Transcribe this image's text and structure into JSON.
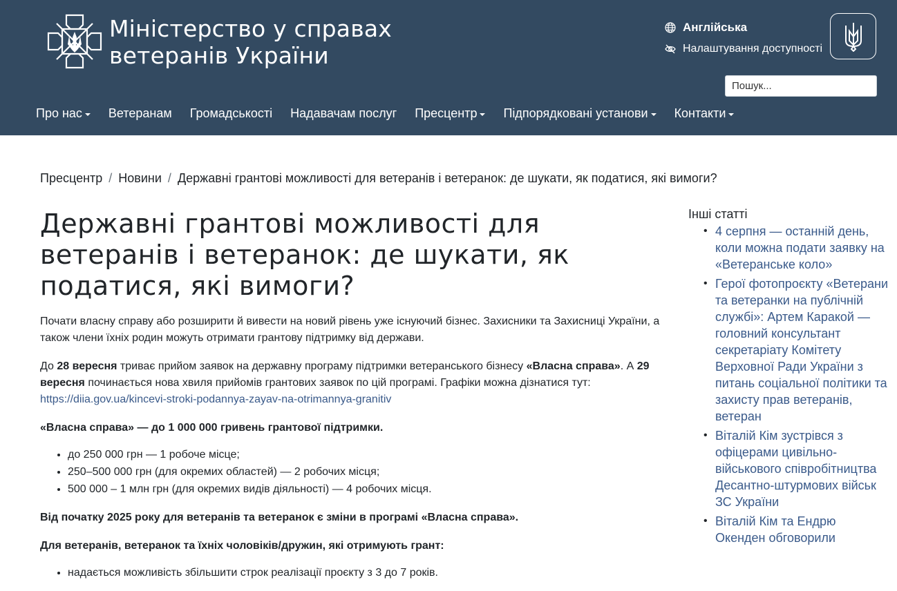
{
  "header": {
    "title_line1": "Міністерство у справах",
    "title_line2": "ветеранів України",
    "language_label": "Англійська",
    "accessibility_label": "Налаштування доступності",
    "search_placeholder": "Пошук...",
    "colors": {
      "header_bg": "#334a61",
      "link": "#3a5a8a"
    }
  },
  "nav": {
    "items": [
      {
        "label": "Про нас",
        "dropdown": true
      },
      {
        "label": "Ветеранам",
        "dropdown": false
      },
      {
        "label": "Громадськості",
        "dropdown": false
      },
      {
        "label": "Надавачам послуг",
        "dropdown": false
      },
      {
        "label": "Пресцентр",
        "dropdown": true
      },
      {
        "label": "Підпорядковані установи",
        "dropdown": true
      },
      {
        "label": "Контакти",
        "dropdown": true
      }
    ]
  },
  "breadcrumb": {
    "items": [
      "Пресцентр",
      "Новини",
      "Державні грантові можливості для ветеранів і ветеранок: де шукати, як податися, які вимоги?"
    ]
  },
  "article": {
    "title": "Державні грантові можливості для ветеранів і ветеранок: де шукати, як податися, які вимоги?",
    "intro": "Почати власну справу або розширити й вивести на новий рівень уже існуючий бізнес. Захисники та Захисниці України, а також члени їхніх родин можуть отримати грантову підтримку від держави.",
    "p2_a": "До ",
    "p2_b": "28 вересня",
    "p2_c": " триває прийом заявок на державну програму підтримки ветеранського бізнесу ",
    "p2_d": "«Власна справа»",
    "p2_e": ". А ",
    "p2_f": "29 вересня",
    "p2_g": " починається нова хвиля прийомів грантових заявок по цій програмі. Графіки можна дізнатися тут:",
    "p2_link": "https://diia.gov.ua/kincevi-stroki-podannya-zayav-na-otrimannya-granitiv",
    "p3": "«Власна справа» — до 1 000 000 гривень грантової підтримки.",
    "list1": [
      "до 250 000 грн — 1 робоче місце;",
      "250–500 000 грн (для окремих областей) — 2 робочих місця;",
      "500 000 – 1 млн грн (для окремих видів діяльності) — 4 робочих місця."
    ],
    "p4": "Від початку 2025 року для ветеранів та ветеранок є зміни в програмі «Власна справа».",
    "p5": "Для ветеранів, ветеранок та їхніх чоловіків/дружин, які отримують грант:",
    "list2": [
      "надається можливість збільшити строк реалізації проєкту з 3 до 7 років."
    ]
  },
  "sidebar": {
    "heading": "Інші статті",
    "items": [
      "4 серпня — останній день, коли можна подати заявку на «Ветеранське коло»",
      "Герої фотопроєкту «Ветерани та ветеранки на публічній службі»: Артем Каракой — головний консультант секретаріату Комітету Верховної Ради України з питань соціальної політики та захисту прав ветеранів, ветеран",
      "Віталій Кім зустрівся з офіцерами цивільно-військового співробітництва Десантно-штурмових військ ЗС України",
      "Віталій Кім та Ендрю Окенден обговорили"
    ]
  }
}
